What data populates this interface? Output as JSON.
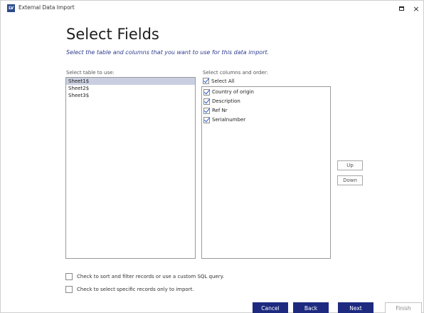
{
  "window": {
    "icon_text": "LV",
    "title": "External Data Import",
    "maximize_label": "",
    "close_label": "×"
  },
  "header": {
    "title": "Select Fields",
    "subtitle": "Select the table and columns that you want to use for this data import."
  },
  "tables": {
    "label": "Select table to use:",
    "items": [
      {
        "label": "Sheet1$",
        "selected": true
      },
      {
        "label": "Sheet2$",
        "selected": false
      },
      {
        "label": "Sheet3$",
        "selected": false
      }
    ]
  },
  "columns": {
    "label": "Select columns and order:",
    "select_all_label": "Select All",
    "select_all_checked": true,
    "items": [
      {
        "label": "Country of origin",
        "checked": true
      },
      {
        "label": "Description",
        "checked": true
      },
      {
        "label": "Ref Nr",
        "checked": true
      },
      {
        "label": "Serialnumber",
        "checked": true
      }
    ]
  },
  "order_buttons": {
    "up_label": "Up",
    "down_label": "Down"
  },
  "options": {
    "custom_sql_label": "Check to sort and filter records or use a custom SQL query.",
    "custom_sql_checked": false,
    "specific_records_label": "Check to select specific records only to import.",
    "specific_records_checked": false
  },
  "footer": {
    "cancel_label": "Cancel",
    "back_label": "Back",
    "next_label": "Next",
    "finish_label": "Finish"
  },
  "colors": {
    "accent": "#1e2a80",
    "subtitle": "#2e3b8e",
    "selection": "#c9cfe0",
    "check": "#2a58c9"
  },
  "icons": {
    "app": "lv-app-icon",
    "maximize": "maximize-icon",
    "close": "close-icon",
    "check": "checkmark-icon"
  }
}
